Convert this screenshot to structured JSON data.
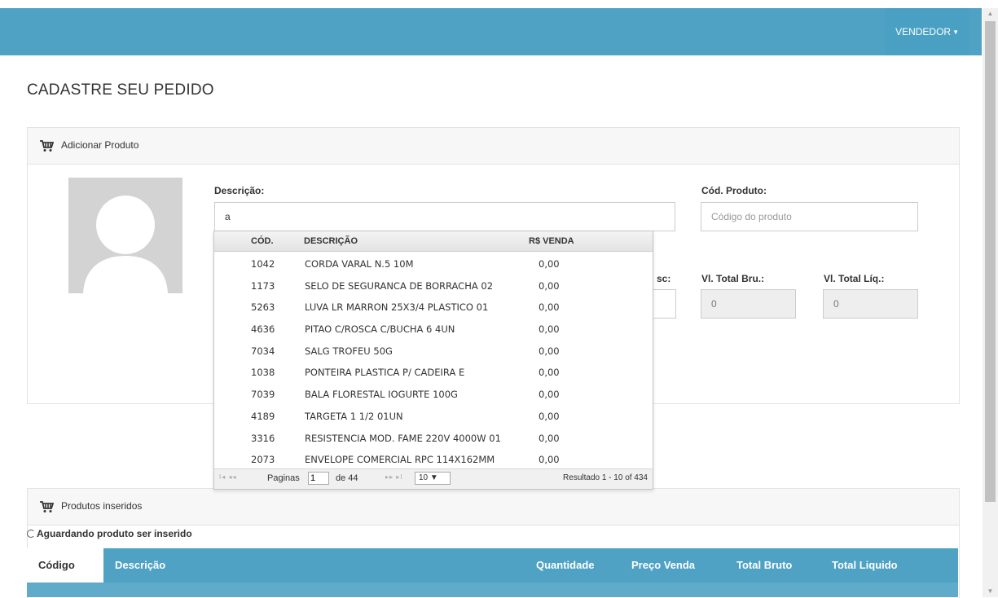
{
  "nav": {
    "user_menu": "VENDEDOR"
  },
  "page_title": "CADASTRE SEU PEDIDO",
  "add_panel": {
    "title": "Adicionar Produto",
    "descricao_label": "Descrição:",
    "descricao_value": "a",
    "cod_label": "Cód. Produto:",
    "cod_placeholder": "Código do produto",
    "desc_label_partial": "sc:",
    "total_bruto_label": "Vl. Total Bru.:",
    "total_bruto_value": "0",
    "total_liquido_label": "Vl. Total Líq.:",
    "total_liquido_value": "0"
  },
  "autocomplete": {
    "headers": {
      "code": "CÓD.",
      "description": "DESCRIÇÃO",
      "price": "R$ VENDA"
    },
    "rows": [
      {
        "code": "1042",
        "description": "CORDA VARAL N.5 10M",
        "price": "0,00"
      },
      {
        "code": "1173",
        "description": "SELO DE SEGURANCA DE BORRACHA 02",
        "price": "0,00"
      },
      {
        "code": "5263",
        "description": "LUVA LR MARRON 25X3/4 PLASTICO 01",
        "price": "0,00"
      },
      {
        "code": "4636",
        "description": "PITAO C/ROSCA C/BUCHA 6 4UN",
        "price": "0,00"
      },
      {
        "code": "7034",
        "description": "SALG TROFEU 50G",
        "price": "0,00"
      },
      {
        "code": "1038",
        "description": "PONTEIRA PLASTICA P/ CADEIRA E",
        "price": "0,00"
      },
      {
        "code": "7039",
        "description": "BALA FLORESTAL IOGURTE 100G",
        "price": "0,00"
      },
      {
        "code": "4189",
        "description": "TARGETA 1 1/2 01UN",
        "price": "0,00"
      },
      {
        "code": "3316",
        "description": "RESISTENCIA MOD. FAME 220V 4000W 01",
        "price": "0,00"
      },
      {
        "code": "2073",
        "description": "ENVELOPE COMERCIAL RPC 114X162MM",
        "price": "0,00"
      }
    ],
    "pager": {
      "first_prev": "I◂ ◂◂",
      "pages_label": "Paginas",
      "page_value": "1",
      "of_label": "de 44",
      "next_last": "▸▸ ▸I",
      "page_size": "10 ▼",
      "result": "Resultado 1 - 10 of 434"
    }
  },
  "products_panel": {
    "title": "Produtos inseridos",
    "status": "Aguardando produto ser inserido",
    "columns": {
      "code": "Código",
      "description": "Descrição",
      "quantity": "Quantidade",
      "price": "Preço Venda",
      "total_gross": "Total Bruto",
      "total_net": "Total Liquido"
    }
  },
  "colors": {
    "header": "#4fa2c3",
    "panel_head": "#f7f7f7"
  },
  "icons": {
    "cart": "cart-icon",
    "avatar": "user-placeholder-icon"
  }
}
